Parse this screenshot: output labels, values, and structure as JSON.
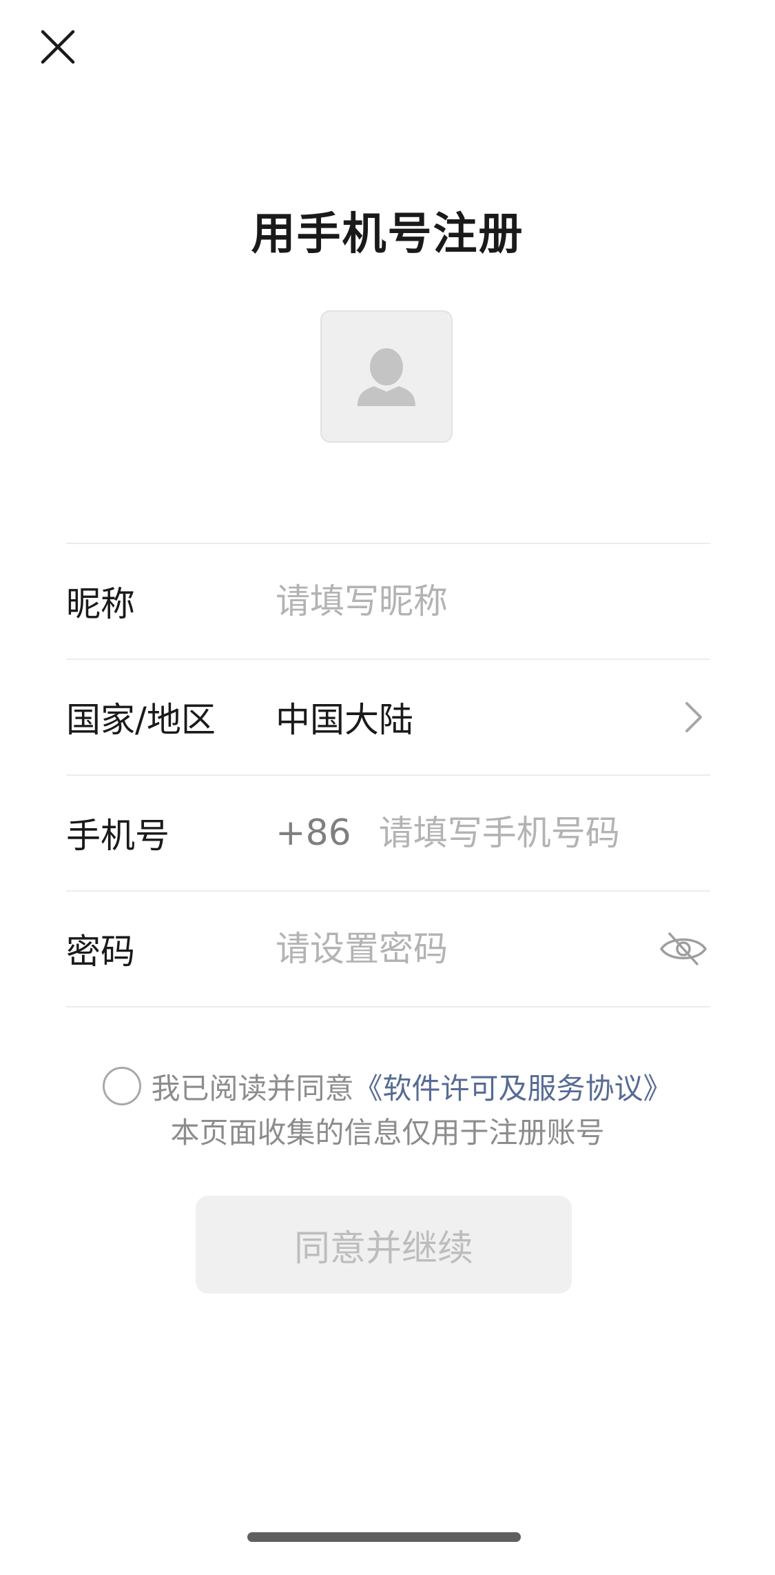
{
  "header": {
    "title": "用手机号注册"
  },
  "icons": {
    "close": "close-icon",
    "avatar": "person-placeholder-icon",
    "chevron": "chevron-right-icon",
    "eye": "eye-off-icon"
  },
  "form": {
    "nickname": {
      "label": "昵称",
      "placeholder": "请填写昵称",
      "value": ""
    },
    "region": {
      "label": "国家/地区",
      "value": "中国大陆"
    },
    "phone": {
      "label": "手机号",
      "country_code": "+86",
      "placeholder": "请填写手机号码",
      "value": ""
    },
    "password": {
      "label": "密码",
      "placeholder": "请设置密码",
      "value": ""
    }
  },
  "agreement": {
    "prefix": "我已阅读并同意",
    "link": "《软件许可及服务协议》",
    "notice": "本页面收集的信息仅用于注册账号"
  },
  "submit": {
    "label": "同意并继续"
  },
  "colors": {
    "link": "#576b95",
    "button_bg": "#f0f0f0",
    "button_text": "#bdbdbd"
  }
}
